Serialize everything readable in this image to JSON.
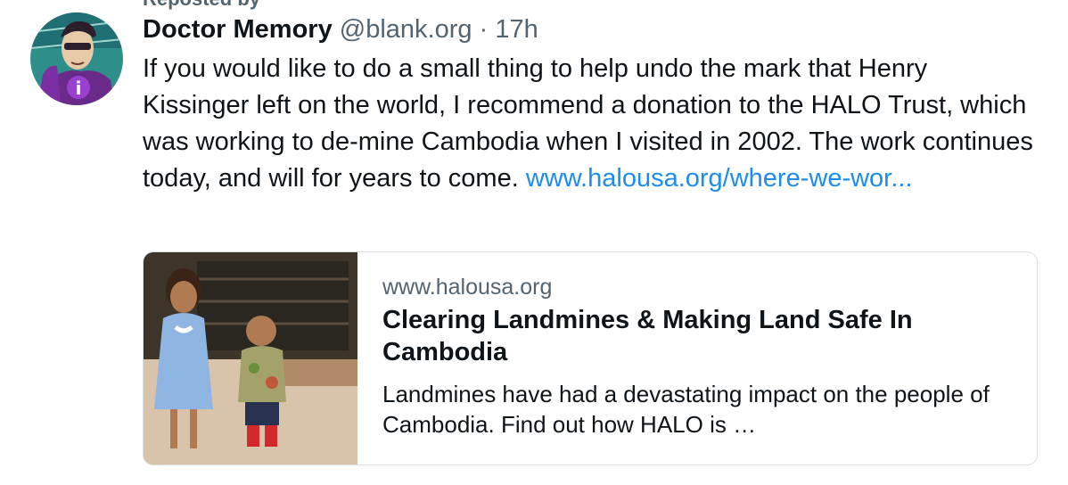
{
  "repost": {
    "text": "Reposted by"
  },
  "post": {
    "author_name": "Doctor Memory",
    "handle": "@blank.org",
    "separator": "·",
    "time": "17h",
    "text": "If you would like to do a small thing to help undo the mark that Henry Kissinger left on the world, I recommend a donation to the HALO Trust, which was working to de-mine Cambodia when I visited in 2002. The work continues today, and will for years to come.",
    "link_text": "www.halousa.org/where-we-wor..."
  },
  "link_card": {
    "domain": "www.halousa.org",
    "title": "Clearing Landmines & Making Land Safe In Cambodia",
    "description": "Landmines have had a devastating impact on the people of Cambodia. Find out how HALO is …"
  },
  "colors": {
    "link": "#1d8cf0",
    "muted": "#536471",
    "text": "#0f1419",
    "card_border": "#d9dee2"
  }
}
